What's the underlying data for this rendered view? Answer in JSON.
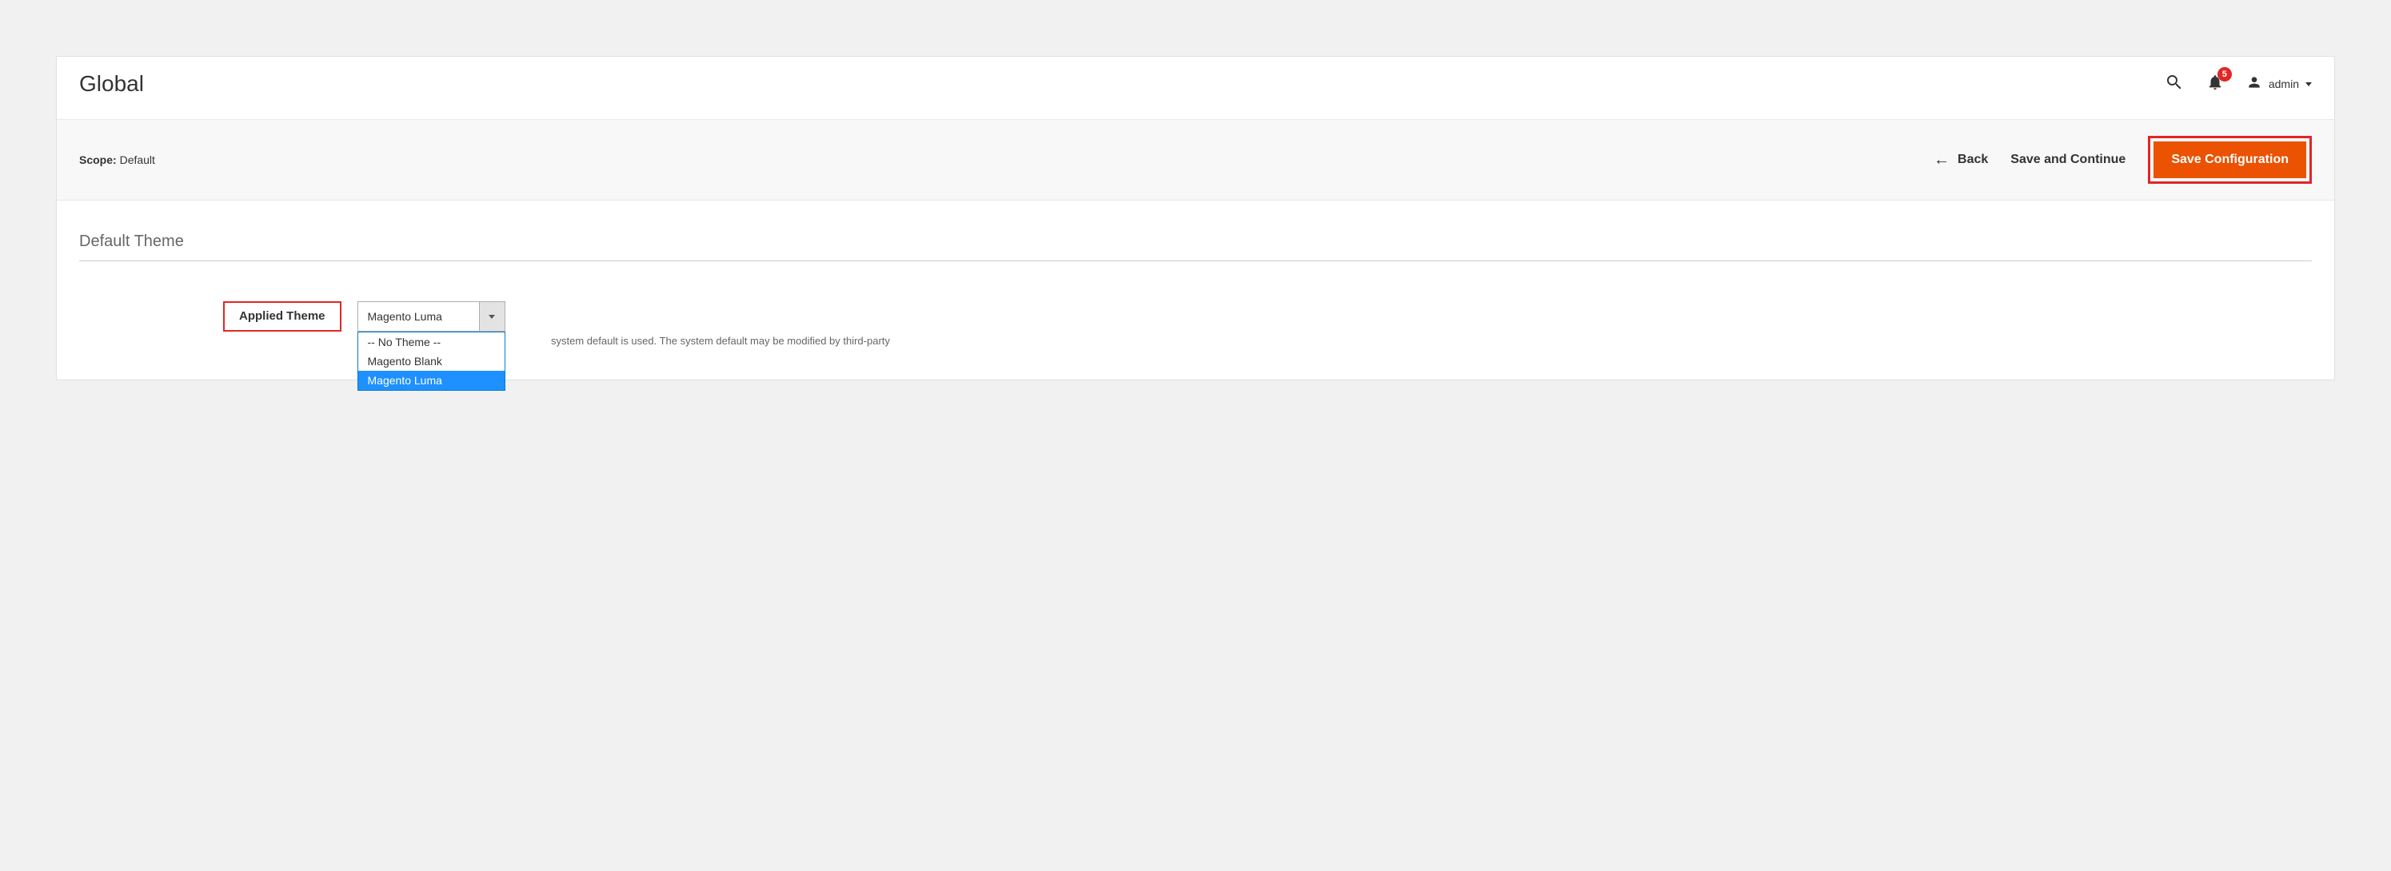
{
  "header": {
    "title": "Global",
    "notification_count": "5",
    "username": "admin"
  },
  "toolbar": {
    "scope_label_prefix": "Scope:",
    "scope_value": "Default",
    "back_label": "Back",
    "save_continue_label": "Save and Continue",
    "save_config_label": "Save Configuration"
  },
  "content": {
    "section_title": "Default Theme",
    "field_label": "Applied Theme",
    "selected_value": "Magento Luma",
    "help_text": "system default is used. The system default may be modified by third-party",
    "dropdown_options": [
      {
        "label": "-- No Theme --",
        "selected": false
      },
      {
        "label": "Magento Blank",
        "selected": false
      },
      {
        "label": "Magento Luma",
        "selected": true
      }
    ]
  }
}
